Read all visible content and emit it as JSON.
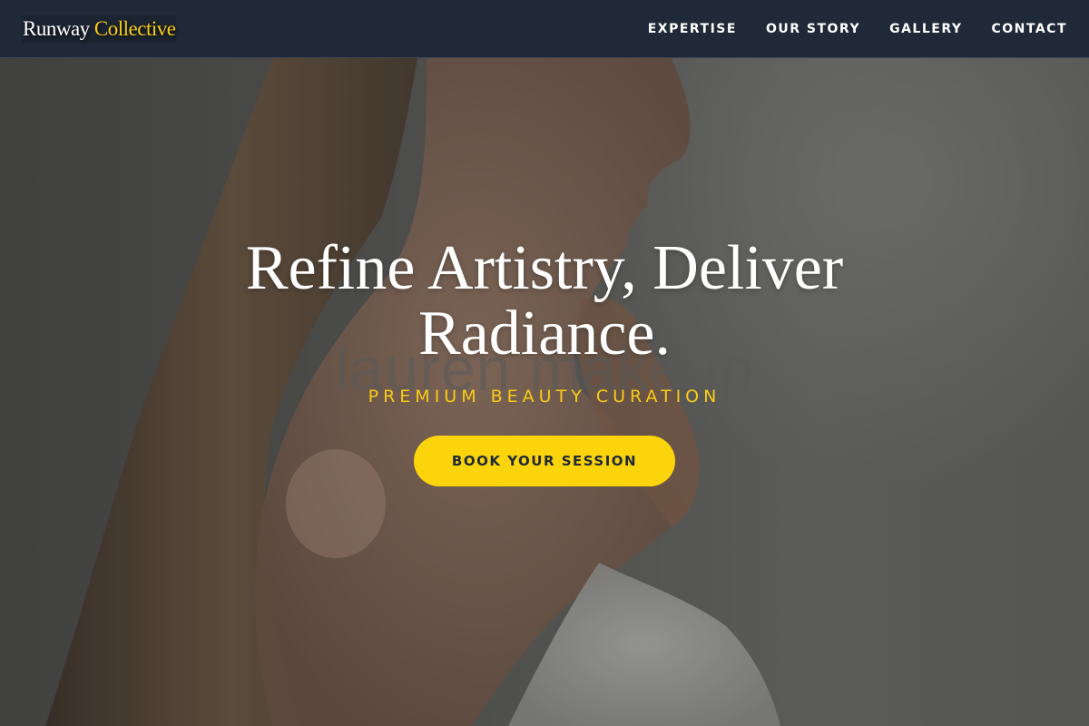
{
  "header": {
    "logo_main": "Runway",
    "logo_accent": "Collective",
    "nav": [
      {
        "label": "EXPERTISE"
      },
      {
        "label": "OUR STORY"
      },
      {
        "label": "GALLERY"
      },
      {
        "label": "CONTACT"
      }
    ]
  },
  "hero": {
    "headline": "Refine Artistry, Deliver Radiance.",
    "tagline": "PREMIUM BEAUTY CURATION",
    "cta_label": "BOOK YOUR SESSION",
    "watermark": "lauren makeup",
    "image_subject": "woman-profile-with-hand-on-chin"
  },
  "colors": {
    "header_bg": "#1f2937",
    "accent": "#facc15",
    "button_bg": "#fcd40b",
    "button_text": "#1f2937"
  }
}
